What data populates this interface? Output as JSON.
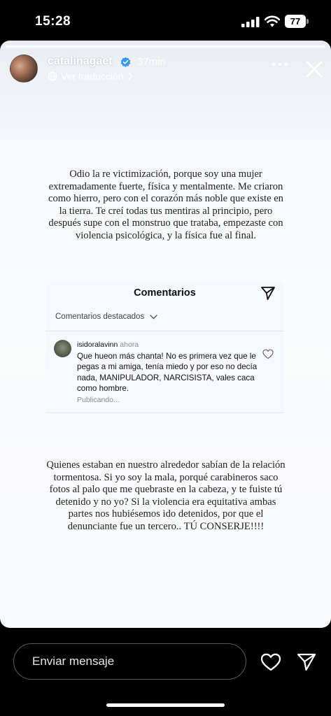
{
  "status_bar": {
    "time": "15:28",
    "battery": "77"
  },
  "story": {
    "username": "catalinagaet",
    "time_ago": "37min",
    "translate_label": "Ver traducción",
    "text_top": "Odio la re victimización, porque soy una mujer extremadamente fuerte, física y mentalmente. Me criaron como hierro, pero con el corazón más noble que existe en la tierra. Te creí todas tus mentiras al principio, pero después supe con el monstruo que trataba, empezaste con violencia psicológica, y la física fue al final.",
    "text_bottom": "Quienes estaban en nuestro alrededor sabían de la relación tormentosa. Si yo soy la mala, porqué carabineros saco fotos al palo que me quebraste en la cabeza, y te fuiste tú detenido y no yo? Si la violencia era equitativa ambas partes nos hubiésemos ido detenidos, por que el denunciante fue un tercero.. TÚ CONSERJE!!!!"
  },
  "comments_screenshot": {
    "title": "Comentarios",
    "filter_label": "Comentarios destacados",
    "comment": {
      "user": "isidoralavinn",
      "time": "ahora",
      "text": "Que hueon más chanta! No es primera vez que le pegas a mi amiga, tenía miedo y por eso no decía nada, MANIPULADOR, NARCISISTA, vales caca como hombre.",
      "status": "Publicando..."
    }
  },
  "reply_bar": {
    "placeholder": "Enviar mensaje"
  },
  "icons": {
    "verified": "verified-badge-icon",
    "more": "more-options-icon",
    "close": "close-icon",
    "like": "heart-icon",
    "share": "paper-plane-icon"
  },
  "colors": {
    "verified_blue": "#3897f0",
    "story_background": "#f8f9fb",
    "text_dark": "#222222"
  }
}
